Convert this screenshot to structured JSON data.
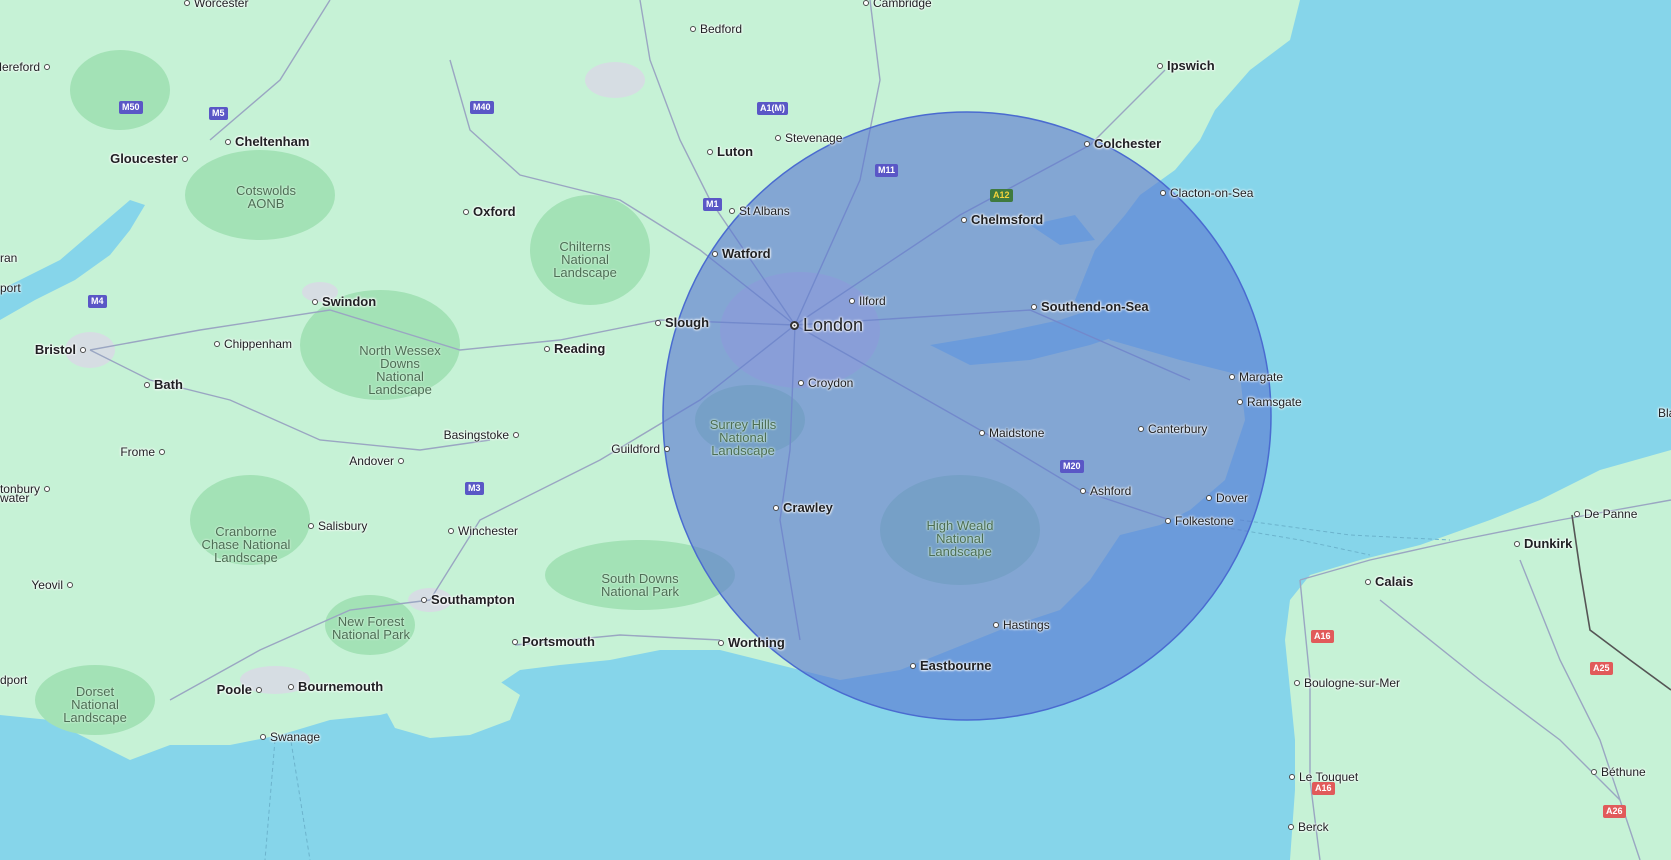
{
  "map": {
    "colors": {
      "water": "#86d5ea",
      "land": "#c6f2d6",
      "forest": "#a3e2b6",
      "urban": "#d6dde3",
      "roads": "#9aa6c2",
      "radius_fill": "#5b78d2",
      "radius_stroke": "#4a6bd0",
      "motorway_shield": "#5a57c6",
      "primary_shield_uk": "#3f7a3f",
      "primary_shield_fr": "#e15a5a"
    },
    "radius_overlay": {
      "center_label": "London",
      "shape": "circle",
      "fill_opacity": 0.62
    },
    "cities": [
      {
        "name": "Worcester",
        "size": "s1"
      },
      {
        "name": "Cambridge",
        "size": "s1"
      },
      {
        "name": "Bedford",
        "size": "s1"
      },
      {
        "name": "Hereford",
        "size": "s1"
      },
      {
        "name": "Ipswich",
        "size": "s2"
      },
      {
        "name": "Cheltenham",
        "size": "s2"
      },
      {
        "name": "Stevenage",
        "size": "s1"
      },
      {
        "name": "Gloucester",
        "size": "s2"
      },
      {
        "name": "Luton",
        "size": "s2"
      },
      {
        "name": "Colchester",
        "size": "s2"
      },
      {
        "name": "Clacton-on-Sea",
        "size": "s1"
      },
      {
        "name": "Oxford",
        "size": "s2"
      },
      {
        "name": "St Albans",
        "size": "s1"
      },
      {
        "name": "Chelmsford",
        "size": "s2"
      },
      {
        "name": "Watford",
        "size": "s2"
      },
      {
        "name": "Swindon",
        "size": "s2"
      },
      {
        "name": "Ilford",
        "size": "s1"
      },
      {
        "name": "Southend-on-Sea",
        "size": "s2"
      },
      {
        "name": "Slough",
        "size": "s2"
      },
      {
        "name": "London",
        "size": "s3"
      },
      {
        "name": "Chippenham",
        "size": "s1"
      },
      {
        "name": "Reading",
        "size": "s2"
      },
      {
        "name": "Bristol",
        "size": "s2"
      },
      {
        "name": "Margate",
        "size": "s1"
      },
      {
        "name": "Bath",
        "size": "s2"
      },
      {
        "name": "Croydon",
        "size": "s1"
      },
      {
        "name": "Ramsgate",
        "size": "s1"
      },
      {
        "name": "Canterbury",
        "size": "s1"
      },
      {
        "name": "Basingstoke",
        "size": "s1"
      },
      {
        "name": "Maidstone",
        "size": "s1"
      },
      {
        "name": "Guildford",
        "size": "s1"
      },
      {
        "name": "Frome",
        "size": "s1"
      },
      {
        "name": "Andover",
        "size": "s1"
      },
      {
        "name": "Glastonbury",
        "size": "s1"
      },
      {
        "name": "Ashford",
        "size": "s1"
      },
      {
        "name": "Dover",
        "size": "s1"
      },
      {
        "name": "Crawley",
        "size": "s2"
      },
      {
        "name": "De Panne",
        "size": "s1"
      },
      {
        "name": "Folkestone",
        "size": "s1"
      },
      {
        "name": "Salisbury",
        "size": "s1"
      },
      {
        "name": "Winchester",
        "size": "s1"
      },
      {
        "name": "Dunkirk",
        "size": "s2"
      },
      {
        "name": "Calais",
        "size": "s2"
      },
      {
        "name": "Yeovil",
        "size": "s1"
      },
      {
        "name": "Southampton",
        "size": "s2"
      },
      {
        "name": "Hastings",
        "size": "s1"
      },
      {
        "name": "Portsmouth",
        "size": "s2"
      },
      {
        "name": "Worthing",
        "size": "s2"
      },
      {
        "name": "Eastbourne",
        "size": "s2"
      },
      {
        "name": "Boulogne-sur-Mer",
        "size": "s1"
      },
      {
        "name": "Poole",
        "size": "s2"
      },
      {
        "name": "Bournemouth",
        "size": "s2"
      },
      {
        "name": "Swanage",
        "size": "s1"
      },
      {
        "name": "Le Touquet",
        "size": "s1"
      },
      {
        "name": "Béthune",
        "size": "s1"
      },
      {
        "name": "Berck",
        "size": "s1"
      }
    ],
    "partial_labels": [
      "ran",
      "port",
      "water",
      "dport",
      "Bla"
    ],
    "parks": [
      {
        "lines": [
          "Cotswolds",
          "AONB"
        ]
      },
      {
        "lines": [
          "Chilterns",
          "National",
          "Landscape"
        ]
      },
      {
        "lines": [
          "North Wessex",
          "Downs",
          "National",
          "Landscape"
        ]
      },
      {
        "lines": [
          "Surrey Hills",
          "National",
          "Landscape"
        ]
      },
      {
        "lines": [
          "High Weald",
          "National",
          "Landscape"
        ]
      },
      {
        "lines": [
          "Cranborne",
          "Chase National",
          "Landscape"
        ]
      },
      {
        "lines": [
          "South Downs",
          "National Park"
        ]
      },
      {
        "lines": [
          "New Forest",
          "National Park"
        ]
      },
      {
        "lines": [
          "Dorset",
          "National",
          "Landscape"
        ]
      }
    ],
    "road_shields": [
      {
        "label": "M50",
        "kind": "motorway"
      },
      {
        "label": "M5",
        "kind": "motorway"
      },
      {
        "label": "M40",
        "kind": "motorway"
      },
      {
        "label": "A1(M)",
        "kind": "motorway"
      },
      {
        "label": "M11",
        "kind": "motorway"
      },
      {
        "label": "A12",
        "kind": "primary_uk"
      },
      {
        "label": "M1",
        "kind": "motorway"
      },
      {
        "label": "M4",
        "kind": "motorway"
      },
      {
        "label": "M20",
        "kind": "motorway"
      },
      {
        "label": "M3",
        "kind": "motorway"
      },
      {
        "label": "A16",
        "kind": "primary_fr"
      },
      {
        "label": "A25",
        "kind": "primary_fr"
      },
      {
        "label": "A16",
        "kind": "primary_fr"
      },
      {
        "label": "A26",
        "kind": "primary_fr"
      }
    ]
  }
}
